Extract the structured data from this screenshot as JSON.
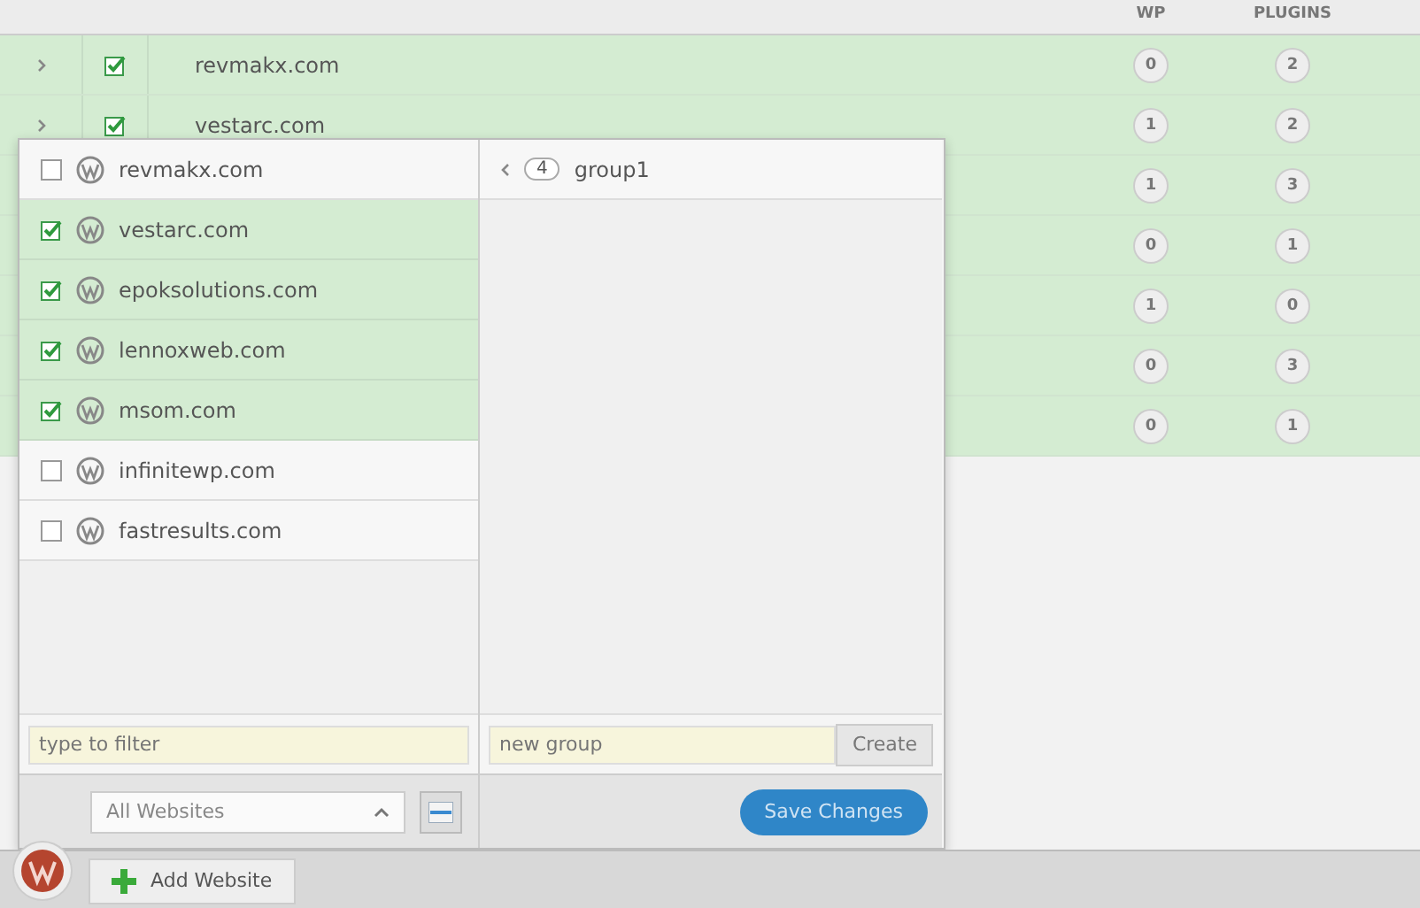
{
  "table": {
    "columns": [
      "WP",
      "PLUGINS"
    ],
    "rows": [
      {
        "site": "revmakx.com",
        "checked": true,
        "wp": "0",
        "plugins": "2"
      },
      {
        "site": "vestarc.com",
        "checked": true,
        "wp": "1",
        "plugins": "2"
      },
      {
        "wp": "1",
        "plugins": "3"
      },
      {
        "wp": "0",
        "plugins": "1"
      },
      {
        "wp": "1",
        "plugins": "0"
      },
      {
        "wp": "0",
        "plugins": "3"
      },
      {
        "wp": "0",
        "plugins": "1"
      }
    ]
  },
  "popup": {
    "sites": [
      {
        "name": "revmakx.com",
        "checked": false
      },
      {
        "name": "vestarc.com",
        "checked": true
      },
      {
        "name": "epoksolutions.com",
        "checked": true
      },
      {
        "name": "lennoxweb.com",
        "checked": true
      },
      {
        "name": "msom.com",
        "checked": true
      },
      {
        "name": "infinitewp.com",
        "checked": false
      },
      {
        "name": "fastresults.com",
        "checked": false
      }
    ],
    "groups": [
      {
        "count": "4",
        "name": "group1"
      }
    ],
    "filter": {
      "placeholder": "type to filter"
    },
    "new_group": {
      "placeholder": "new group"
    },
    "create_button": "Create",
    "scope_select": "All Websites",
    "save_button": "Save Changes"
  },
  "bottom_bar": {
    "add_button": "Add Website"
  }
}
